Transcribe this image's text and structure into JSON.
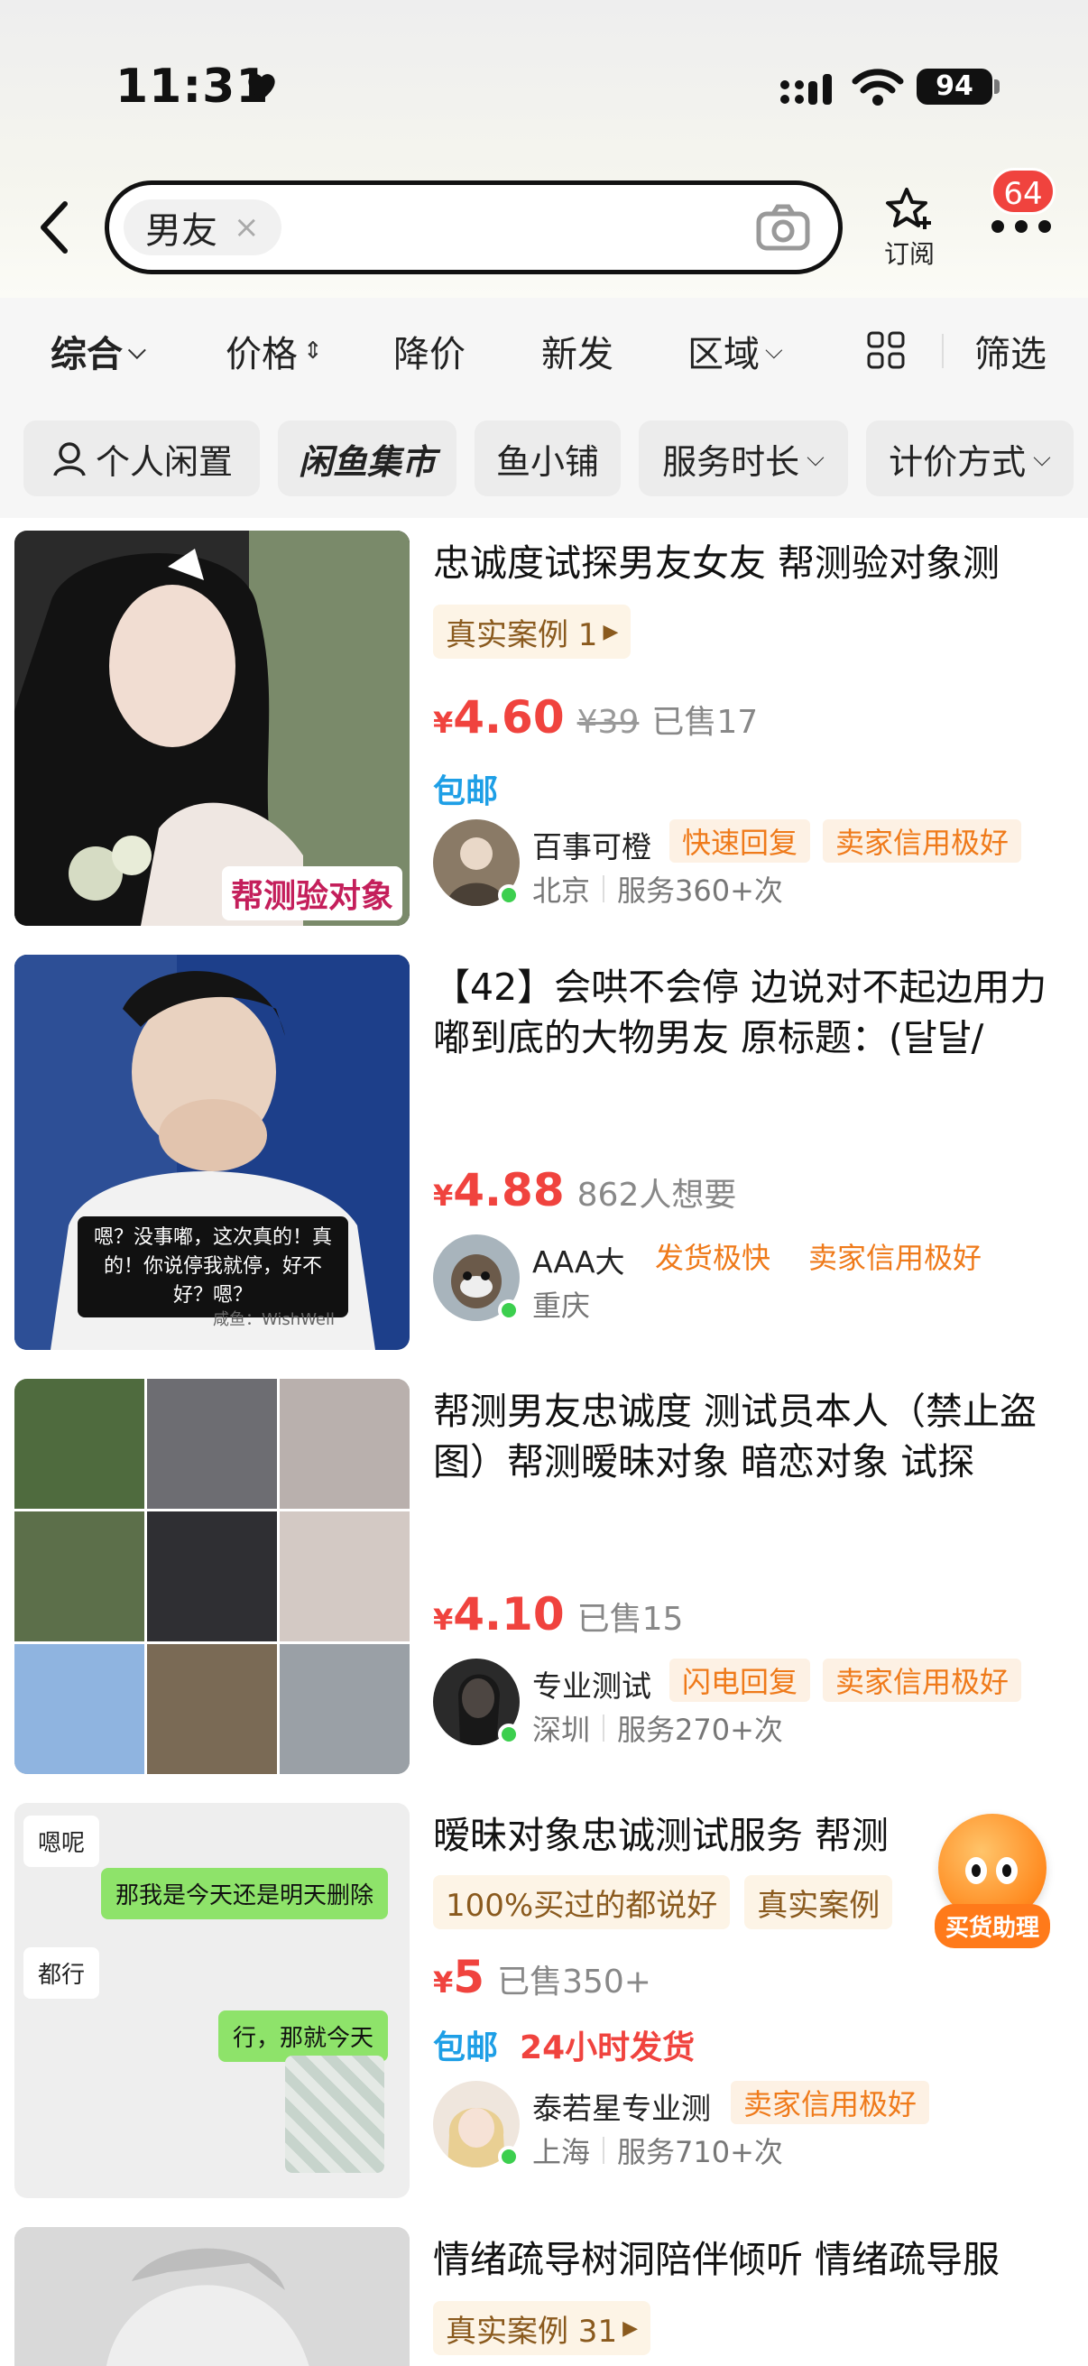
{
  "status": {
    "time": "11:31",
    "battery": "94"
  },
  "search": {
    "query": "男友",
    "clear": "×",
    "subscribe": "订阅",
    "badge": "64"
  },
  "sort": {
    "items": [
      "综合",
      "价格",
      "降价",
      "新发",
      "区域"
    ],
    "filter": "筛选"
  },
  "filters": [
    "个人闲置",
    "闲鱼集市",
    "鱼小铺",
    "服务时长",
    "计价方式"
  ],
  "listings": [
    {
      "title": "忠诚度试探男友女友 帮测验对象测",
      "tag": "真实案例 1",
      "price": "4.60",
      "currency": "¥",
      "old_price": "¥39",
      "meta": "已售17",
      "free_ship": "包邮",
      "thumb_caption": "帮测验对象",
      "seller": {
        "name": "百事可橙",
        "tags": [
          "快速回复",
          "卖家信用极好"
        ],
        "city": "北京",
        "service": "服务360+次"
      }
    },
    {
      "title": "【42】会哄不会停 边说对不起边用力嘟到底的大物男友 原标题：(달달/",
      "price": "4.88",
      "currency": "¥",
      "meta": "862人想要",
      "thumb_quote": "嗯？没事嘟，这次真的！真的！你说停我就停，好不好？嗯？",
      "thumb_watermark": "咸鱼：WishWell",
      "seller": {
        "name": "AAA大",
        "tags": [
          "发货极快",
          "卖家信用极好"
        ],
        "city": "重庆"
      }
    },
    {
      "title": "帮测男友忠诚度 测试员本人（禁止盗图）帮测暧昧对象 暗恋对象 试探",
      "price": "4.10",
      "currency": "¥",
      "meta": "已售15",
      "seller": {
        "name": "专业测试",
        "tags": [
          "闪电回复",
          "卖家信用极好"
        ],
        "city": "深圳",
        "service": "服务270+次"
      }
    },
    {
      "title": "暧昧对象忠诚测试服务 帮测",
      "tags": [
        "100%买过的都说好",
        "真实案例"
      ],
      "price": "5",
      "currency": "¥",
      "meta": "已售350+",
      "free_ship": "包邮",
      "fast_ship": "24小时发货",
      "thumb_chat": [
        "嗯呢",
        "那我是今天还是明天删除",
        "都行",
        "行，那就今天"
      ],
      "seller": {
        "name": "泰若星专业测",
        "tags": [
          "卖家信用极好"
        ],
        "city": "上海",
        "service": "服务710+次"
      }
    },
    {
      "title": "情绪疏导树洞陪伴倾听 情绪疏导服",
      "tag": "真实案例 31"
    }
  ],
  "helper": {
    "label": "买货助理"
  },
  "colors": {
    "price": "#f0433e",
    "free_ship": "#1e9fe6",
    "seller_tag": "#ef7a1a",
    "online": "#3ccf4e"
  }
}
